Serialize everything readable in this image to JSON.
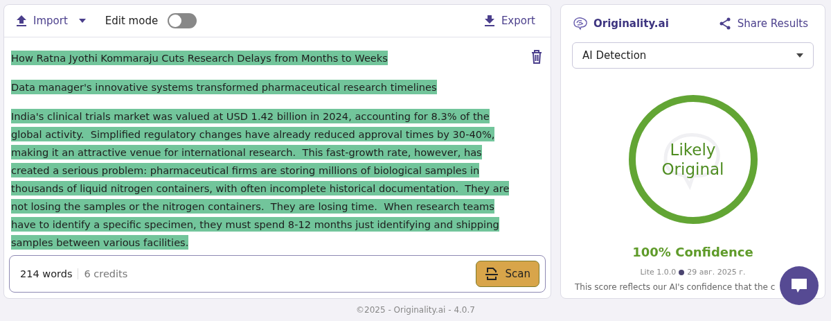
{
  "toolbar": {
    "import_label": "Import",
    "edit_mode": {
      "label": "Edit mode",
      "on": false
    },
    "export_label": "Export"
  },
  "document": {
    "paragraphs": [
      {
        "lines": [
          {
            "text": "How Ratna Jyothi Kommaraju Cuts Research Delays from Months to Weeks",
            "highlighted": true
          }
        ]
      },
      {
        "lines": [
          {
            "text": "Data manager's innovative systems transformed pharmaceutical research timelines",
            "highlighted": true
          }
        ]
      },
      {
        "lines": [
          {
            "text": "India's clinical trials market was valued at USD 1.42 billion in 2024, accounting for 8.3% of the",
            "highlighted": true
          },
          {
            "text": "global activity.  Simplified regulatory changes have already reduced approval times by 30-40%,",
            "highlighted": true
          },
          {
            "text": "making it an attractive venue for international research.  This fast-growth rate, however, has",
            "highlighted": true
          },
          {
            "text": "created a serious problem: pharmaceutical firms are storing millions of biological samples in",
            "highlighted": true
          },
          {
            "text": "thousands of liquid nitrogen containers, with often incomplete historical documentation.  They are",
            "highlighted": true
          },
          {
            "text": "not losing the samples or the nitrogen containers.  They are losing time.  When research teams",
            "highlighted": true
          },
          {
            "text": "have to identify a specific specimen, they must spend 8-12 months just identifying and shipping",
            "highlighted": true
          },
          {
            "text": "samples between various facilities.",
            "highlighted": true
          }
        ]
      }
    ]
  },
  "status": {
    "words": "214 words",
    "credits": "6 credits",
    "scan_label": "Scan"
  },
  "results": {
    "brand": "Originality.ai",
    "share_label": "Share Results",
    "mode": "AI Detection",
    "verdict_line_1": "Likely",
    "verdict_line_2": "Original",
    "level": 1.0,
    "confidence": "100% Confidence",
    "version": "Lite 1.0.0",
    "date": "29 авг. 2025 г.",
    "note": "This score reflects our AI's confidence that the c"
  },
  "footer": "©2025 - Originality.ai - 4.0.7"
}
